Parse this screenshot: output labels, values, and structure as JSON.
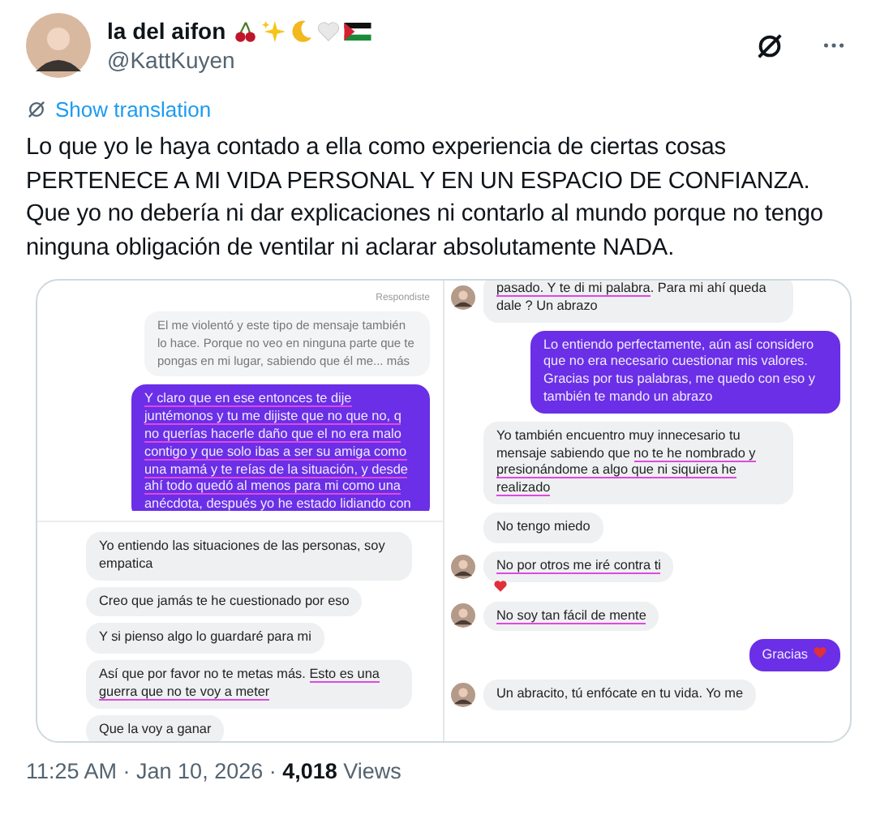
{
  "author": {
    "name": "la del aifon",
    "handle": "@KattKuyen"
  },
  "translate_link": "Show translation",
  "text": "Lo que yo le haya contado a ella como experiencia de ciertas cosas PERTENECE A MI VIDA PERSONAL Y EN UN ESPACIO DE CONFIANZA. Que yo no debería ni dar explicaciones ni contarlo al mundo porque no tengo ninguna obligación de ventilar ni aclarar absolutamente NADA.",
  "media": {
    "left_top": {
      "reply_label": "Respondiste",
      "messages": [
        {
          "kind": "reply",
          "parts": [
            {
              "text": "El me violentó y este tipo de mensaje también lo hace. Porque no veo en ninguna parte que te pongas en mi lugar, sabiendo que él me... más",
              "underlined": false
            }
          ]
        },
        {
          "kind": "out",
          "parts": [
            {
              "text": "Y claro que en ese entonces te dije juntémonos y tu me dijiste que no que no, q no querías hacerle daño que el no era malo contigo y que solo ibas a ser su amiga como una mamá y te reías de la situación, y desde ahí todo quedó al menos para mi como una anécdota, después yo he estado lidiando con",
              "underlined": true
            }
          ]
        }
      ]
    },
    "left_bottom": {
      "messages": [
        {
          "kind": "in",
          "parts": [
            {
              "text": "Yo entiendo las situaciones de las personas, soy empatica",
              "underlined": false
            }
          ]
        },
        {
          "kind": "in",
          "parts": [
            {
              "text": "Creo que jamás te he cuestionado por eso",
              "underlined": false
            }
          ]
        },
        {
          "kind": "in",
          "parts": [
            {
              "text": "Y si pienso algo lo guardaré para mi",
              "underlined": false
            }
          ]
        },
        {
          "kind": "in",
          "parts": [
            {
              "text": "Así que por favor no te metas más. ",
              "underlined": false
            },
            {
              "text": "Esto es una guerra que no te voy a meter",
              "underlined": true
            }
          ]
        },
        {
          "kind": "in",
          "parts": [
            {
              "text": "Que la voy a ganar",
              "underlined": false
            }
          ]
        }
      ]
    },
    "right": {
      "messages": [
        {
          "kind": "in",
          "avatar": true,
          "reaction": false,
          "heart": false,
          "parts": [
            {
              "text": "pasado. Y te di mi palabra",
              "underlined": true
            },
            {
              "text": ". Para mi ahí queda dale ? Un abrazo",
              "underlined": false
            }
          ]
        },
        {
          "kind": "out",
          "avatar": false,
          "reaction": false,
          "heart": false,
          "parts": [
            {
              "text": "Lo entiendo perfectamente, aún así considero que no era necesario cuestionar mis valores. Gracias por tus palabras, me quedo con eso y también te mando un abrazo",
              "underlined": false
            }
          ]
        },
        {
          "kind": "in",
          "avatar": false,
          "reaction": false,
          "heart": false,
          "parts": [
            {
              "text": "Yo también encuentro muy innecesario tu mensaje sabiendo que ",
              "underlined": false
            },
            {
              "text": "no te he nombrado y presionándome a algo que ni siquiera he realizado",
              "underlined": true
            }
          ]
        },
        {
          "kind": "in",
          "avatar": false,
          "reaction": false,
          "heart": false,
          "parts": [
            {
              "text": "No tengo miedo",
              "underlined": false
            }
          ]
        },
        {
          "kind": "in",
          "avatar": true,
          "reaction": true,
          "heart": false,
          "parts": [
            {
              "text": "No por otros me iré contra ti",
              "underlined": true
            }
          ]
        },
        {
          "kind": "in",
          "avatar": true,
          "reaction": false,
          "heart": false,
          "parts": [
            {
              "text": "No soy tan fácil de mente",
              "underlined": true
            }
          ]
        },
        {
          "kind": "out",
          "avatar": false,
          "reaction": false,
          "heart": true,
          "parts": [
            {
              "text": "Gracias",
              "underlined": false
            }
          ]
        },
        {
          "kind": "in",
          "avatar": true,
          "reaction": false,
          "heart": false,
          "parts": [
            {
              "text": "Un abracito, tú enfócate en tu vida. Yo me",
              "underlined": false
            }
          ]
        }
      ]
    }
  },
  "footer": "11:25 AM · Jan 10, 2026 · **4,018** Views"
}
